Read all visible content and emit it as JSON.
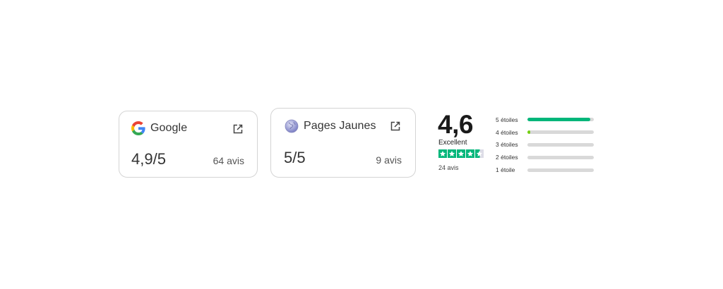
{
  "google": {
    "name": "Google",
    "score": "4,9/5",
    "count": "64 avis",
    "logo_icon": "google-g-icon",
    "link_icon": "external-link-icon"
  },
  "pages_jaunes": {
    "name": "Pages Jaunes",
    "score": "5/5",
    "count": "9 avis",
    "logo_icon": "globe-icon",
    "link_icon": "external-link-icon"
  },
  "trustpilot": {
    "score": "4,6",
    "label": "Excellent",
    "count": "24 avis",
    "stars": 4.5,
    "star_color": "#00b67a",
    "distribution": [
      {
        "label": "5 étoiles",
        "fraction": 0.95,
        "color": "#00b67a"
      },
      {
        "label": "4 étoiles",
        "fraction": 0.04,
        "color": "#73cf11"
      },
      {
        "label": "3 étoiles",
        "fraction": 0.0,
        "color": "#ffce00"
      },
      {
        "label": "2 étoiles",
        "fraction": 0.0,
        "color": "#ff8622"
      },
      {
        "label": "1 étoile",
        "fraction": 0.0,
        "color": "#ff3722"
      }
    ]
  }
}
